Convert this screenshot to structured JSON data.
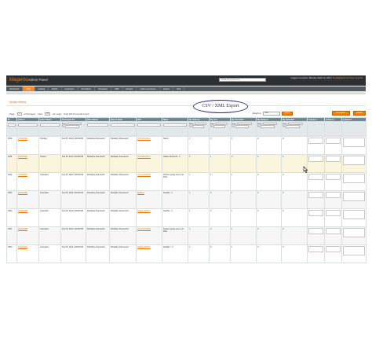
{
  "header": {
    "logo_brand": "Magento",
    "logo_sub": "Admin Panel",
    "search_placeholder": "Global Record Search",
    "user_info": "Logged in as admin | Monday, March 10, 2014 |",
    "tip": "Try Magento Go for Free | Log Out"
  },
  "nav": [
    {
      "label": "Dashboard",
      "active": false
    },
    {
      "label": "Sales",
      "active": true
    },
    {
      "label": "Catalog",
      "active": false
    },
    {
      "label": "Mobile",
      "active": false
    },
    {
      "label": "Customers",
      "active": false
    },
    {
      "label": "Promotions",
      "active": false
    },
    {
      "label": "Newsletter",
      "active": false
    },
    {
      "label": "CMS",
      "active": false
    },
    {
      "label": "Reports",
      "active": false
    },
    {
      "label": "Inside ecommerce",
      "active": false
    },
    {
      "label": "System",
      "active": false
    },
    {
      "label": "Help",
      "active": false
    }
  ],
  "page_title": "Order Items",
  "callout": "CSV / XML Export",
  "buttons": {
    "reset_filter": "Reset Filter",
    "search": "Search"
  },
  "pager": {
    "page_label": "Page",
    "page_value": "1",
    "of_pages": "of 33 pages",
    "view_label": "View",
    "per_page_value": "20",
    "per_page_label": "per page",
    "total": "Total 10173 records found"
  },
  "export": {
    "label": "Export to:",
    "format": "CSV",
    "button": "Export"
  },
  "columns": [
    "ID",
    "Order #",
    "Order Status",
    "Purchased On",
    "Bill to Name",
    "Ship to Name",
    "SKU",
    "Name",
    "My Ordered",
    "My Live",
    "My Cancelled",
    "My Shipped",
    "My Refunded",
    "Column 1",
    "Column 2",
    "Column 3"
  ],
  "filter_labels": {
    "from": "From :",
    "to": "To :"
  },
  "rows": [
    {
      "id": "2546",
      "order": "100001993",
      "status": "Pending",
      "date": "Feb 25, 2014 3:28:59 PM",
      "bill": "Rodolphe Franceschi",
      "ship": "Rodolphe Franceschi",
      "sku": "NTCHAD-DIA-e",
      "name": "Nuclei",
      "ordered": "1",
      "live": "0",
      "cancelled": "0",
      "shipped": "0",
      "refunded": "0"
    },
    {
      "id": "2545",
      "order": "100001992",
      "status": "Closed",
      "date": "Feb 25, 2014 3:28:00 PM",
      "bill": "Rodolphe Franceschi",
      "ship": "Rodolphe Franceschi",
      "sku": "NTCHAD-DIA-e",
      "name": "Collant dorina 22 - 2",
      "ordered": "1",
      "live": "1",
      "cancelled": "0",
      "shipped": "0",
      "refunded": "0"
    },
    {
      "id": "2544",
      "order": "100001991",
      "status": "Cancelled",
      "date": "Feb 25, 2014 3:28:00 PM",
      "bill": "Rodolphe Franceschi",
      "ship": "Rodolphe Franceschi",
      "sku": "AD-LOUIS-B/20",
      "name": "Souliers gorge avec nuit - 4/30",
      "ordered": "1",
      "live": "0",
      "cancelled": "1",
      "shipped": "0",
      "refunded": "0"
    },
    {
      "id": "2543",
      "order": "100001990",
      "status": "Cancelled",
      "date": "Feb 25, 2014 3:28:00 PM",
      "bill": "Rodolphe Franceschi",
      "ship": "Rodolphe Franceschi",
      "sku": "NUDE-4",
      "name": "Nudeffe - 4",
      "ordered": "1",
      "live": "0",
      "cancelled": "1",
      "shipped": "0",
      "refunded": "0"
    },
    {
      "id": "2542",
      "order": "100001989",
      "status": "Cancelled",
      "date": "Feb 25, 2014 3:28:00 PM",
      "bill": "Rodolphe Franceschi",
      "ship": "Rodolphe Franceschi",
      "sku": "NUDEA-B/5D-3",
      "name": "Nudeffe - 3",
      "ordered": "1",
      "live": "0",
      "cancelled": "1",
      "shipped": "0",
      "refunded": "0"
    },
    {
      "id": "2541",
      "order": "100001988",
      "status": "Cancelled",
      "date": "Feb 25, 2014 3:28:00 PM",
      "bill": "Rodolphe Franceschi",
      "ship": "Rodolphe Franceschi",
      "sku": "AD-LOUIS-B/20",
      "name": "Souliers gorge avec nuit - 4/30",
      "ordered": "1",
      "live": "0",
      "cancelled": "1",
      "shipped": "0",
      "refunded": "0"
    },
    {
      "id": "2540",
      "order": "100001987",
      "status": "Cancelled",
      "date": "Feb 25, 2014 3:28:00 PM",
      "bill": "Rodolphe Franceschi",
      "ship": "Rodolphe Franceschi",
      "sku": "NUDEA-B/5D-3",
      "name": "Nudeffe - 3",
      "ordered": "1",
      "live": "0",
      "cancelled": "1",
      "shipped": "0",
      "refunded": "0"
    }
  ]
}
